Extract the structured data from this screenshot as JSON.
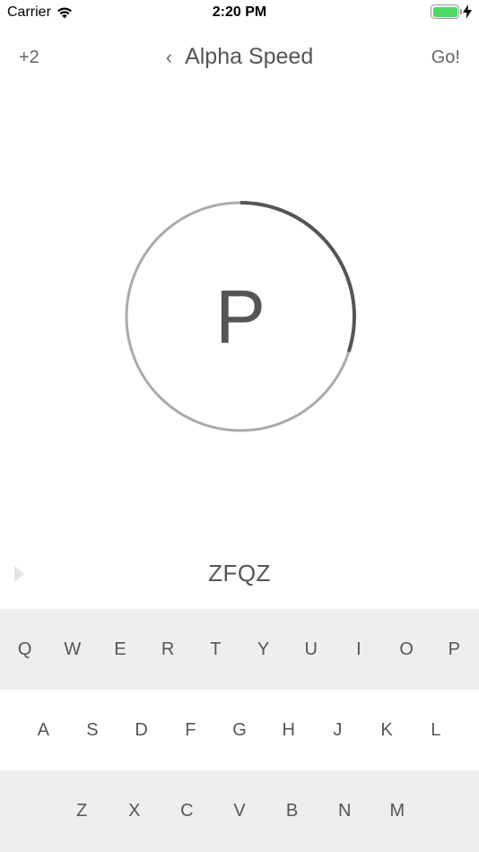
{
  "status_bar": {
    "carrier": "Carrier",
    "time": "2:20 PM",
    "battery_color": "#4cd964"
  },
  "nav": {
    "left_label": "+2",
    "back_icon": "chevron-left-icon",
    "title": "Alpha Speed",
    "right_label": "Go!"
  },
  "timer": {
    "letter": "P",
    "progress": 0.3,
    "track_color": "#aaaaaa",
    "progress_color": "#555555"
  },
  "entry": {
    "icon": "play-icon",
    "text": "ZFQZ"
  },
  "keyboard": {
    "rows": [
      [
        "Q",
        "W",
        "E",
        "R",
        "T",
        "Y",
        "U",
        "I",
        "O",
        "P"
      ],
      [
        "A",
        "S",
        "D",
        "F",
        "G",
        "H",
        "J",
        "K",
        "L"
      ],
      [
        "Z",
        "X",
        "C",
        "V",
        "B",
        "N",
        "M"
      ]
    ]
  }
}
